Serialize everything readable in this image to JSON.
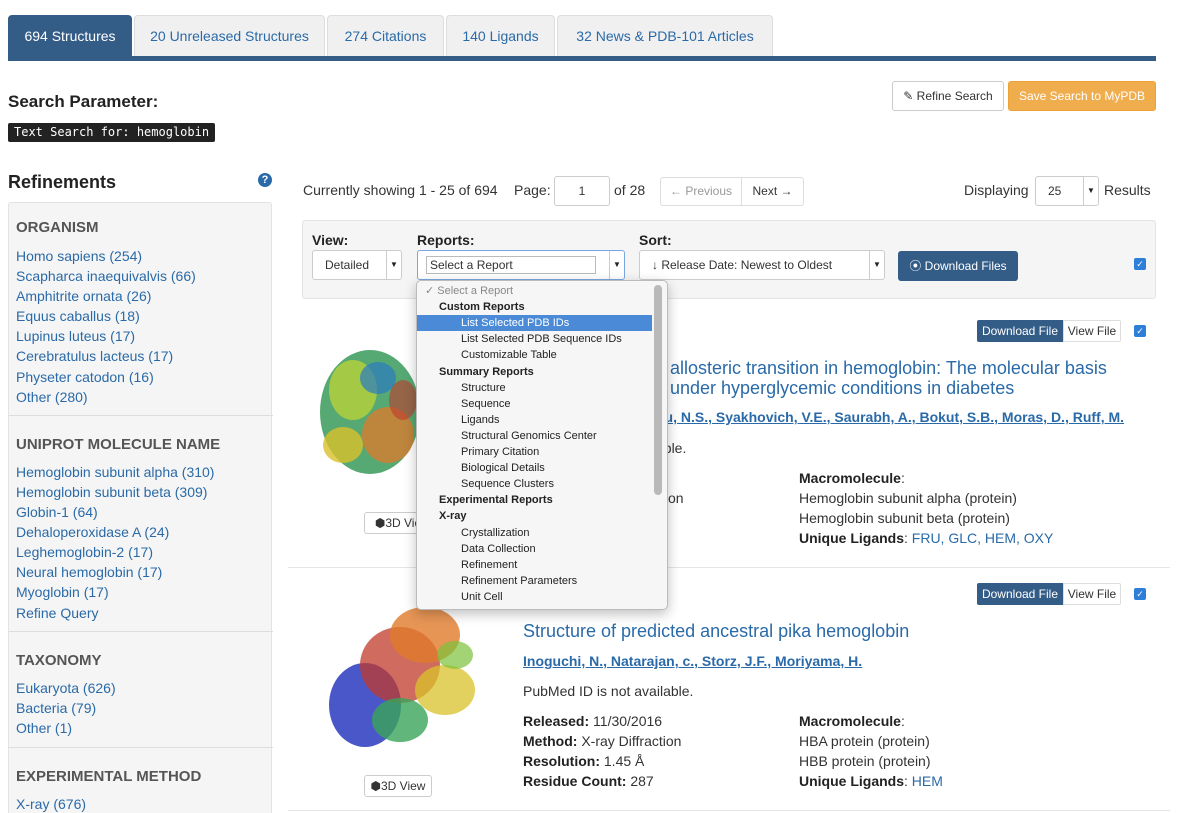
{
  "tabs": [
    "694 Structures",
    "20 Unreleased Structures",
    "274 Citations",
    "140 Ligands",
    "32 News & PDB-101 Articles"
  ],
  "search": {
    "title": "Search Parameter:",
    "query": "Text Search for: hemoglobin",
    "refine_button": "Refine Search",
    "save_button": "Save Search to MyPDB"
  },
  "refinements": {
    "title": "Refinements",
    "help_glyph": "?",
    "facets": [
      {
        "title": "ORGANISM",
        "items": [
          "Homo sapiens (254)",
          "Scapharca inaequivalvis (66)",
          "Amphitrite ornata (26)",
          "Equus caballus (18)",
          "Lupinus luteus (17)",
          "Cerebratulus lacteus (17)",
          "Physeter catodon (16)",
          "Other (280)"
        ]
      },
      {
        "title": "UNIPROT MOLECULE NAME",
        "items": [
          "Hemoglobin subunit alpha (310)",
          "Hemoglobin subunit beta (309)",
          "Globin-1 (64)",
          "Dehaloperoxidase A (24)",
          "Leghemoglobin-2 (17)",
          "Neural hemoglobin (17)",
          "Myoglobin (17)",
          "Refine Query"
        ]
      },
      {
        "title": "TAXONOMY",
        "items": [
          "Eukaryota (626)",
          "Bacteria (79)",
          "Other (1)"
        ]
      },
      {
        "title": "EXPERIMENTAL METHOD",
        "items": [
          "X-ray (676)"
        ]
      }
    ]
  },
  "paging": {
    "showing": "Currently showing 1 - 25 of 694",
    "page_label": "Page:",
    "page_value": "1",
    "of_pages": "of 28",
    "prev": "← Previous",
    "next": "Next →",
    "displaying": "Displaying",
    "per_page": "25",
    "results": "Results"
  },
  "toolbar": {
    "view_label": "View:",
    "view_value": "Detailed",
    "reports_label": "Reports:",
    "reports_value": "Select a Report",
    "sort_label": "Sort:",
    "sort_value": "↓ Release Date: Newest to Oldest",
    "download_files": "⦿ Download Files"
  },
  "dropdown": {
    "items": [
      {
        "label": "✓  Select a Report",
        "kind": "placeholder"
      },
      {
        "label": "Custom Reports",
        "kind": "group"
      },
      {
        "label": "List Selected PDB IDs",
        "kind": "option",
        "selected": true
      },
      {
        "label": "List Selected PDB Sequence IDs",
        "kind": "option"
      },
      {
        "label": "Customizable Table",
        "kind": "option"
      },
      {
        "label": "Summary Reports",
        "kind": "group"
      },
      {
        "label": "Structure",
        "kind": "option"
      },
      {
        "label": "Sequence",
        "kind": "option"
      },
      {
        "label": "Ligands",
        "kind": "option"
      },
      {
        "label": "Structural Genomics Center",
        "kind": "option"
      },
      {
        "label": "Primary Citation",
        "kind": "option"
      },
      {
        "label": "Biological Details",
        "kind": "option"
      },
      {
        "label": "Sequence Clusters",
        "kind": "option"
      },
      {
        "label": "Experimental Reports",
        "kind": "group"
      },
      {
        "label": "X-ray",
        "kind": "group"
      },
      {
        "label": "Crystallization",
        "kind": "option"
      },
      {
        "label": "Data Collection",
        "kind": "option"
      },
      {
        "label": "Refinement",
        "kind": "option"
      },
      {
        "label": "Refinement Parameters",
        "kind": "option"
      },
      {
        "label": "Unit Cell",
        "kind": "option"
      }
    ]
  },
  "results": [
    {
      "download_file": "Download File",
      "view_file": "View File",
      "title_line1": "s allosteric transition in hemoglobin: The molecular basis",
      "title_line2": "s under hyperglycemic conditions in diabetes",
      "authors": "nu, N.S., Syakhovich, V.E., Saurabh, A., Bokut, S.B., Moras, D., Ruff, M.",
      "pubmed": "able.",
      "method_tail": "on",
      "macromolecule_label": "Macromolecule",
      "macromolecules": [
        "Hemoglobin subunit alpha (protein)",
        "Hemoglobin subunit beta (protein)"
      ],
      "ligands_label": "Unique Ligands",
      "ligands": "FRU, GLC, HEM, OXY",
      "view3d": "3D Vie"
    },
    {
      "download_file": "Download File",
      "view_file": "View File",
      "title": "Structure of predicted ancestral pika hemoglobin",
      "authors": "Inoguchi, N., Natarajan, c., Storz, J.F., Moriyama, H.",
      "pubmed": "PubMed ID is not available.",
      "released_label": "Released:",
      "released": "11/30/2016",
      "method_label": "Method:",
      "method": "X-ray Diffraction",
      "resolution_label": "Resolution:",
      "resolution": "1.45 Å",
      "residue_label": "Residue Count:",
      "residue": "287",
      "macromolecule_label": "Macromolecule",
      "macromolecules": [
        "HBA protein (protein)",
        "HBB protein (protein)"
      ],
      "ligands_label": "Unique Ligands",
      "ligands": "HEM",
      "view3d": "3D View"
    }
  ],
  "colors": {
    "brand": "#335c87",
    "link": "#2a6aa8",
    "warning": "#f0ad4e",
    "checkbox": "#2d7fd8"
  },
  "icons": {
    "pencil": "pencil-icon",
    "cube": "cube-icon",
    "check": "check-icon"
  }
}
